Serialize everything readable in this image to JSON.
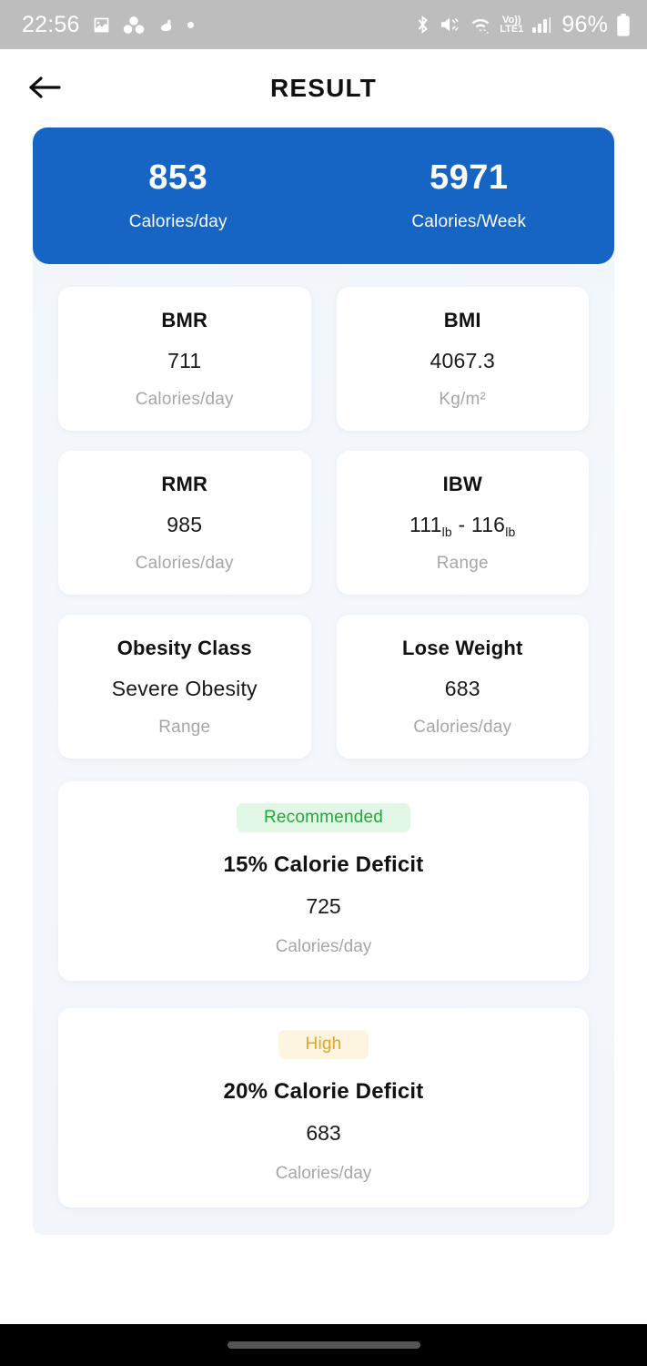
{
  "status_bar": {
    "time": "22:56",
    "battery_percent": "96%",
    "left_icons": [
      "image-icon",
      "group-circles-icon",
      "duck-icon",
      "dot-icon"
    ],
    "right_icons": [
      "bluetooth-icon",
      "mute-icon",
      "wifi-icon",
      "volte-lte1-icon",
      "signal-bars-icon",
      "battery-icon"
    ],
    "volte_top": "Vo))",
    "volte_bottom": "LTE1"
  },
  "header": {
    "title": "RESULT",
    "back_icon": "arrow-left-icon"
  },
  "summary": {
    "items": [
      {
        "value": "853",
        "label": "Calories/day"
      },
      {
        "value": "5971",
        "label": "Calories/Week"
      }
    ]
  },
  "metrics": [
    {
      "title": "BMR",
      "value": "711",
      "unit": "Calories/day"
    },
    {
      "title": "BMI",
      "value": "4067.3",
      "unit": "Kg/m²"
    },
    {
      "title": "RMR",
      "value": "985",
      "unit": "Calories/day"
    },
    {
      "title": "IBW",
      "value_main_1": "111",
      "value_sub_1": "lb",
      "value_sep": " - ",
      "value_main_2": "116",
      "value_sub_2": "lb",
      "unit": "Range"
    },
    {
      "title": "Obesity Class",
      "value": "Severe Obesity",
      "unit": "Range"
    },
    {
      "title": "Lose Weight",
      "value": "683",
      "unit": "Calories/day"
    }
  ],
  "deficits": [
    {
      "badge": "Recommended",
      "title": "15% Calorie Deficit",
      "value": "725",
      "unit": "Calories/day"
    },
    {
      "badge": "High",
      "title": "20% Calorie Deficit",
      "value": "683",
      "unit": "Calories/day"
    }
  ],
  "colors": {
    "accent_blue": "#1665c4",
    "badge_recommended_text": "#23a83a",
    "badge_recommended_bg": "#e2f7e5",
    "badge_high_text": "#e0a52a",
    "badge_high_bg": "#fdf5df",
    "page_bg": "#f2f6fb",
    "status_bar_bg": "#bdbdbd"
  }
}
